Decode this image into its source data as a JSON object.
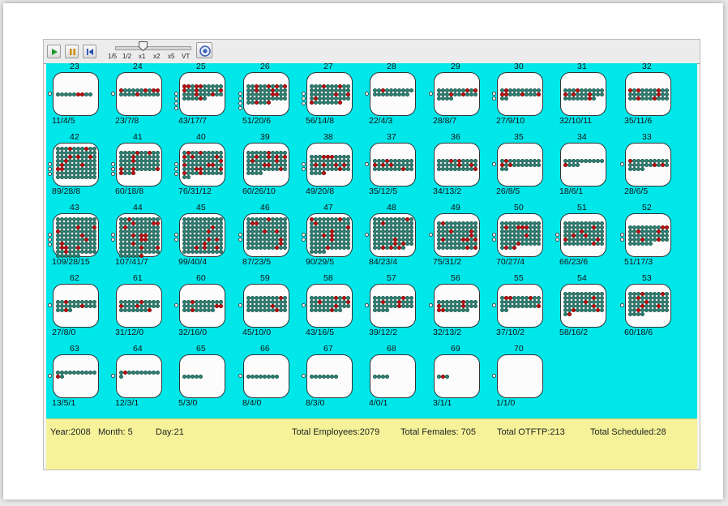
{
  "controls": {
    "play_icon": "play-icon",
    "pause_icon": "pause-icon",
    "rewind_icon": "rewind-icon",
    "settings_icon": "gear-icon",
    "speeds": [
      "1/5",
      "1/2",
      "x1",
      "x2",
      "x5",
      "VT"
    ],
    "speed_value": "x1"
  },
  "colors": {
    "background": "#00e7ea",
    "employee": "#2e8577",
    "female": "#cc1111",
    "status_bar": "#f5f29a"
  },
  "units": [
    {
      "id": "23",
      "stats": "11/4/5",
      "n": 9,
      "red": 2,
      "outside": 1
    },
    {
      "id": "24",
      "stats": "23/7/8",
      "n": 20,
      "red": 5,
      "outside": 1
    },
    {
      "id": "25",
      "stats": "43/17/7",
      "n": 36,
      "red": 10,
      "outside": 4
    },
    {
      "id": "26",
      "stats": "51/20/6",
      "n": 46,
      "red": 10,
      "outside": 4
    },
    {
      "id": "27",
      "stats": "56/14/8",
      "n": 48,
      "red": 7,
      "outside": 3
    },
    {
      "id": "28",
      "stats": "22/4/3",
      "n": 19,
      "red": 1,
      "outside": 1
    },
    {
      "id": "29",
      "stats": "28/8/7",
      "n": 24,
      "red": 4,
      "outside": 1
    },
    {
      "id": "30",
      "stats": "27/9/10",
      "n": 22,
      "red": 5,
      "outside": 2
    },
    {
      "id": "31",
      "stats": "32/10/11",
      "n": 28,
      "red": 5,
      "outside": 0
    },
    {
      "id": "32",
      "stats": "35/11/6",
      "n": 30,
      "red": 6,
      "outside": 0
    },
    {
      "id": "42",
      "stats": "89/28/8",
      "n": 80,
      "red": 10,
      "outside": 3
    },
    {
      "id": "41",
      "stats": "60/18/8",
      "n": 54,
      "red": 9,
      "outside": 3
    },
    {
      "id": "40",
      "stats": "76/31/12",
      "n": 62,
      "red": 14,
      "outside": 3
    },
    {
      "id": "39",
      "stats": "60/26/10",
      "n": 54,
      "red": 10,
      "outside": 0
    },
    {
      "id": "38",
      "stats": "49/20/8",
      "n": 44,
      "red": 9,
      "outside": 2
    },
    {
      "id": "37",
      "stats": "35/12/5",
      "n": 30,
      "red": 5,
      "outside": 1
    },
    {
      "id": "36",
      "stats": "34/13/2",
      "n": 30,
      "red": 5,
      "outside": 0
    },
    {
      "id": "35",
      "stats": "26/8/5",
      "n": 22,
      "red": 3,
      "outside": 1
    },
    {
      "id": "34",
      "stats": "18/6/1",
      "n": 14,
      "red": 1,
      "outside": 0
    },
    {
      "id": "33",
      "stats": "28/6/5",
      "n": 24,
      "red": 3,
      "outside": 1
    },
    {
      "id": "43",
      "stats": "109/28/15",
      "n": 96,
      "red": 10,
      "outside": 3
    },
    {
      "id": "44",
      "stats": "107/41/7",
      "n": 96,
      "red": 14,
      "outside": 2
    },
    {
      "id": "45",
      "stats": "99/40/4",
      "n": 90,
      "red": 8,
      "outside": 2
    },
    {
      "id": "46",
      "stats": "87/23/5",
      "n": 80,
      "red": 8,
      "outside": 2
    },
    {
      "id": "47",
      "stats": "90/29/5",
      "n": 84,
      "red": 9,
      "outside": 2
    },
    {
      "id": "48",
      "stats": "84/23/4",
      "n": 78,
      "red": 8,
      "outside": 1
    },
    {
      "id": "49",
      "stats": "75/31/2",
      "n": 70,
      "red": 10,
      "outside": 1
    },
    {
      "id": "50",
      "stats": "70/27/4",
      "n": 64,
      "red": 8,
      "outside": 2
    },
    {
      "id": "51",
      "stats": "66/23/6",
      "n": 60,
      "red": 7,
      "outside": 2
    },
    {
      "id": "52",
      "stats": "51/17/3",
      "n": 46,
      "red": 6,
      "outside": 2
    },
    {
      "id": "62",
      "stats": "27/8/0",
      "n": 24,
      "red": 3,
      "outside": 1
    },
    {
      "id": "61",
      "stats": "31/12/0",
      "n": 28,
      "red": 4,
      "outside": 0
    },
    {
      "id": "60",
      "stats": "32/16/0",
      "n": 28,
      "red": 4,
      "outside": 1
    },
    {
      "id": "59",
      "stats": "45/10/0",
      "n": 40,
      "red": 3,
      "outside": 1
    },
    {
      "id": "58",
      "stats": "43/16/5",
      "n": 38,
      "red": 6,
      "outside": 1
    },
    {
      "id": "57",
      "stats": "39/12/2",
      "n": 34,
      "red": 4,
      "outside": 1
    },
    {
      "id": "56",
      "stats": "32/13/2",
      "n": 28,
      "red": 5,
      "outside": 1
    },
    {
      "id": "55",
      "stats": "37/10/2",
      "n": 32,
      "red": 4,
      "outside": 1
    },
    {
      "id": "54",
      "stats": "58/16/2",
      "n": 52,
      "red": 6,
      "outside": 0
    },
    {
      "id": "53",
      "stats": "60/18/6",
      "n": 54,
      "red": 7,
      "outside": 1
    },
    {
      "id": "63",
      "stats": "13/5/1",
      "n": 12,
      "red": 1,
      "outside": 1
    },
    {
      "id": "64",
      "stats": "12/3/1",
      "n": 11,
      "red": 1,
      "outside": 1
    },
    {
      "id": "65",
      "stats": "5/3/0",
      "n": 5,
      "red": 0,
      "outside": 0
    },
    {
      "id": "66",
      "stats": "8/4/0",
      "n": 8,
      "red": 0,
      "outside": 1
    },
    {
      "id": "67",
      "stats": "8/3/0",
      "n": 7,
      "red": 0,
      "outside": 1
    },
    {
      "id": "68",
      "stats": "4/0/1",
      "n": 4,
      "red": 0,
      "outside": 0
    },
    {
      "id": "69",
      "stats": "3/1/1",
      "n": 3,
      "red": 1,
      "outside": 0
    },
    {
      "id": "70",
      "stats": "1/1/0",
      "n": 0,
      "red": 0,
      "outside": 1
    }
  ],
  "status": {
    "year": "Year:2008",
    "month": "Month: 5",
    "day": "Day:21",
    "total_employees": "Total Employees:2079",
    "total_females": "Total Females: 705",
    "total_otftp": "Total OTFTP:213",
    "total_scheduled": "Total Scheduled:28"
  }
}
